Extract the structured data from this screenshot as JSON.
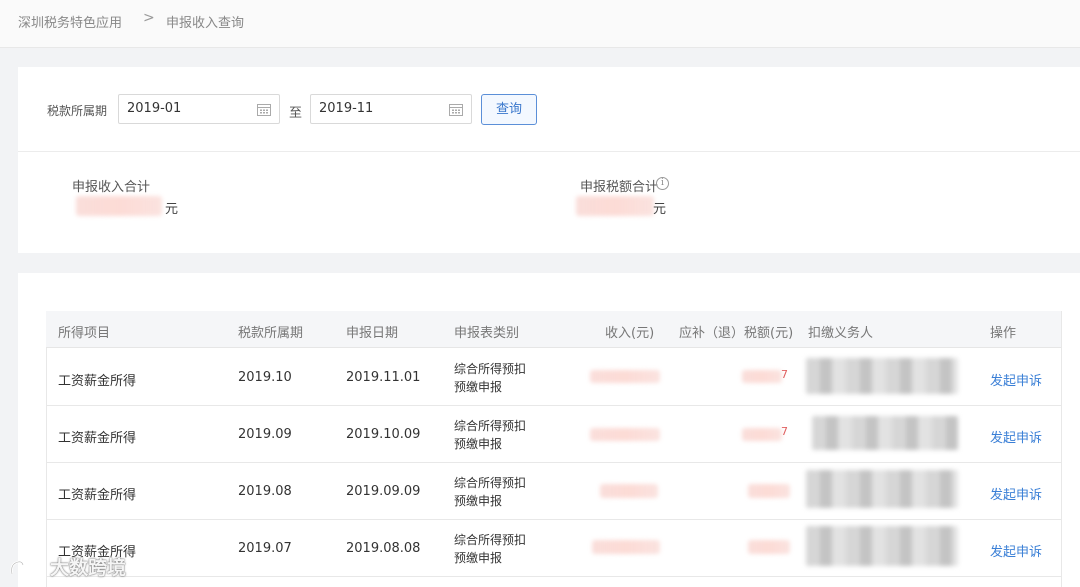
{
  "breadcrumb": {
    "root": "深圳税务特色应用",
    "separator": ">",
    "current": "申报收入查询"
  },
  "filter": {
    "period_label": "税款所属期",
    "start_value": "2019-01",
    "to_label": "至",
    "end_value": "2019-11",
    "query_label": "查询"
  },
  "summary": {
    "income_label": "申报收入合计",
    "income_unit": "元",
    "tax_label": "申报税额合计",
    "tax_unit": "元",
    "info_symbol": "i"
  },
  "table": {
    "headers": [
      "所得项目",
      "税款所属期",
      "申报日期",
      "申报表类别",
      "收入(元)",
      "应补（退）税额(元)",
      "扣缴义务人",
      "操作"
    ],
    "rows": [
      {
        "item": "工资薪金所得",
        "period": "2019.10",
        "date": "2019.11.01",
        "type_line1": "综合所得预扣",
        "type_line2": "预缴申报",
        "tax_tail": "7",
        "action": "发起申诉"
      },
      {
        "item": "工资薪金所得",
        "period": "2019.09",
        "date": "2019.10.09",
        "type_line1": "综合所得预扣",
        "type_line2": "预缴申报",
        "tax_tail": "7",
        "action": "发起申诉"
      },
      {
        "item": "工资薪金所得",
        "period": "2019.08",
        "date": "2019.09.09",
        "type_line1": "综合所得预扣",
        "type_line2": "预缴申报",
        "tax_tail": "",
        "action": "发起申诉"
      },
      {
        "item": "工资薪金所得",
        "period": "2019.07",
        "date": "2019.08.08",
        "type_line1": "综合所得预扣",
        "type_line2": "预缴申报",
        "tax_tail": "",
        "action": "发起申诉"
      }
    ]
  },
  "watermark": {
    "text": "大数跨境"
  },
  "colors": {
    "link": "#3a7fd6",
    "button_border": "#5b8fd8",
    "page_bg": "#f2f3f5"
  }
}
